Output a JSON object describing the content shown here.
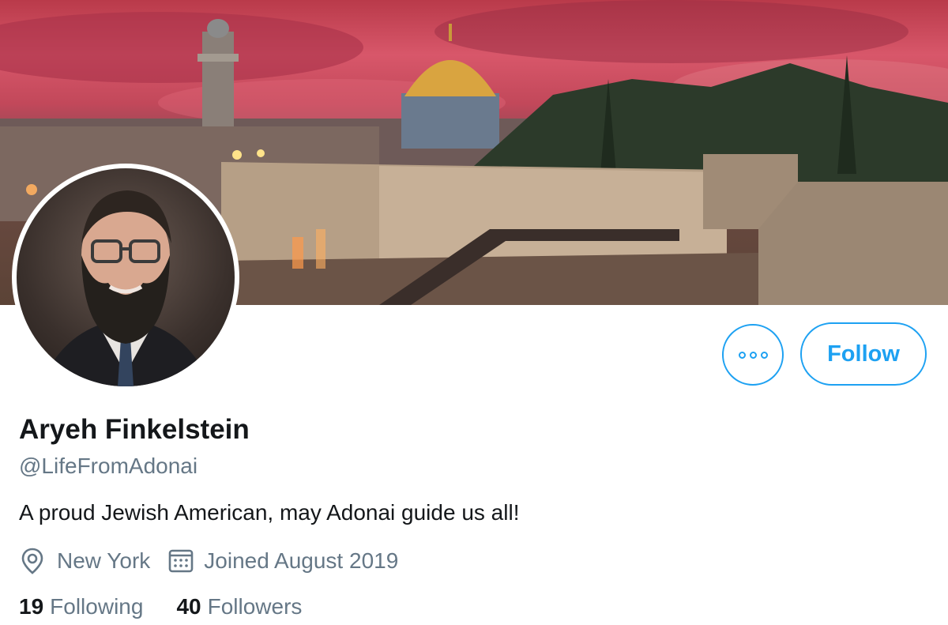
{
  "profile": {
    "name": "Aryeh Finkelstein",
    "handle": "@LifeFromAdonai",
    "bio": "A proud Jewish American, may Adonai guide us all!",
    "location": "New York",
    "joined": "Joined August 2019"
  },
  "actions": {
    "follow_label": "Follow",
    "more_icon": "more-options-icon"
  },
  "stats": {
    "following_count": "19",
    "following_label": "Following",
    "followers_count": "40",
    "followers_label": "Followers"
  },
  "icons": {
    "location": "location-pin-icon",
    "calendar": "calendar-icon"
  },
  "colors": {
    "accent": "#1da1f2",
    "secondary_text": "#657786",
    "primary_text": "#14171a"
  }
}
